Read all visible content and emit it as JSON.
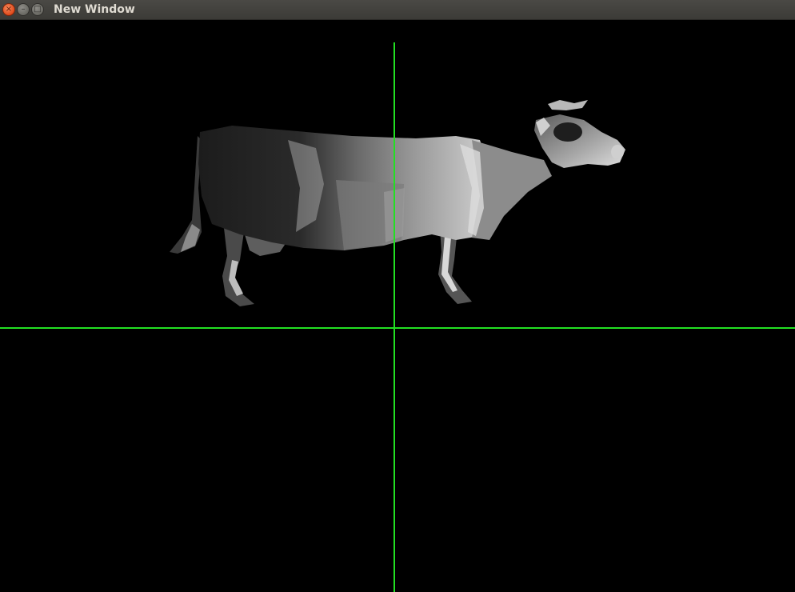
{
  "window": {
    "title": "New Window",
    "buttons": {
      "close_glyph": "×",
      "minimize_glyph": "–",
      "maximize_glyph": "□"
    }
  },
  "viewport": {
    "background_color": "#000000",
    "axis_color": "#22e022",
    "model_icon": "cow-model"
  }
}
